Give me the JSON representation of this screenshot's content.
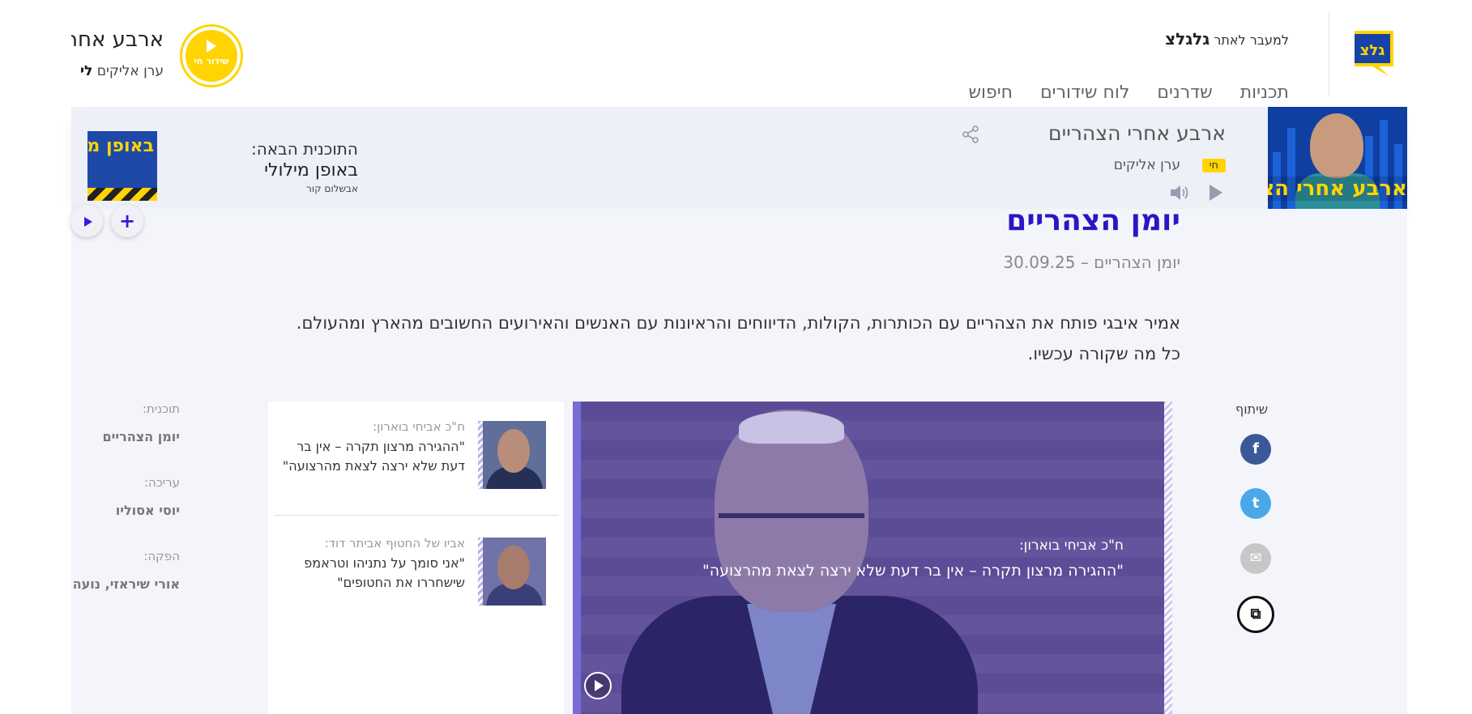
{
  "header": {
    "site_link_prefix": "למעבר לאתר",
    "site_brand": "גלגלצ",
    "logo_text": "גלצ",
    "nav": [
      "תכניות",
      "שדרנים",
      "לוח שידורים",
      "חיפוש"
    ],
    "live_badge_label": "שידור חי",
    "current_show_title": "ארבע אחרי הצהריים",
    "current_show_host_prefix": "ערן אליקים",
    "current_show_host_suffix": "לי"
  },
  "player": {
    "show_title": "ארבע אחרי הצהריים",
    "live_tag": "חי",
    "host": "ערן אליקים",
    "thumb_text": "ארבע אחרי הצהריים",
    "next_label": "התוכנית הבאה:",
    "next_title": "באופן מילולי",
    "next_host": "אבשלום קור",
    "next_thumb_text": "באופן מילולי"
  },
  "page": {
    "title": "יומן הצהריים",
    "date_line": "יומן הצהריים – 30.09.25",
    "description_line1": "אמיר איבגי פותח את הצהריים עם הכותרות, הקולות, הדיווחים והראיונות עם האנשים והאירועים החשובים מהארץ ומהעולם.",
    "description_line2": "כל מה שקורה עכשיו."
  },
  "share": {
    "label": "שיתוף",
    "facebook": "f",
    "twitter": "t",
    "mail": "✉",
    "copy": "⧉"
  },
  "video": {
    "caption_who": "ח\"כ אביחי בוארון:",
    "caption_quote": "\"ההגירה מרצון תקרה – אין בר דעת שלא ירצה לצאת מהרצועה\""
  },
  "related": [
    {
      "who": "ח\"כ אביחי בוארון:",
      "quote": "\"ההגירה מרצון תקרה – אין בר דעת שלא ירצה לצאת מהרצועה\""
    },
    {
      "who": "אביו של החטוף אביתר דוד:",
      "quote": "\"אני סומך על נתניהו וטראמפ שישחררו את החטופים\""
    }
  ],
  "credits": {
    "program_label": "תוכנית:",
    "program_value": "יומן הצהריים",
    "editing_label": "עריכה:",
    "editing_value": "יוסי אסוליו",
    "production_label": "הפקה:",
    "production_value": "אורי שיראזי, נועה"
  },
  "colors": {
    "brand_yellow": "#ffd400",
    "title_blue": "#2a16c4",
    "facebook": "#3b5998",
    "twitter": "#4aa8e8"
  }
}
